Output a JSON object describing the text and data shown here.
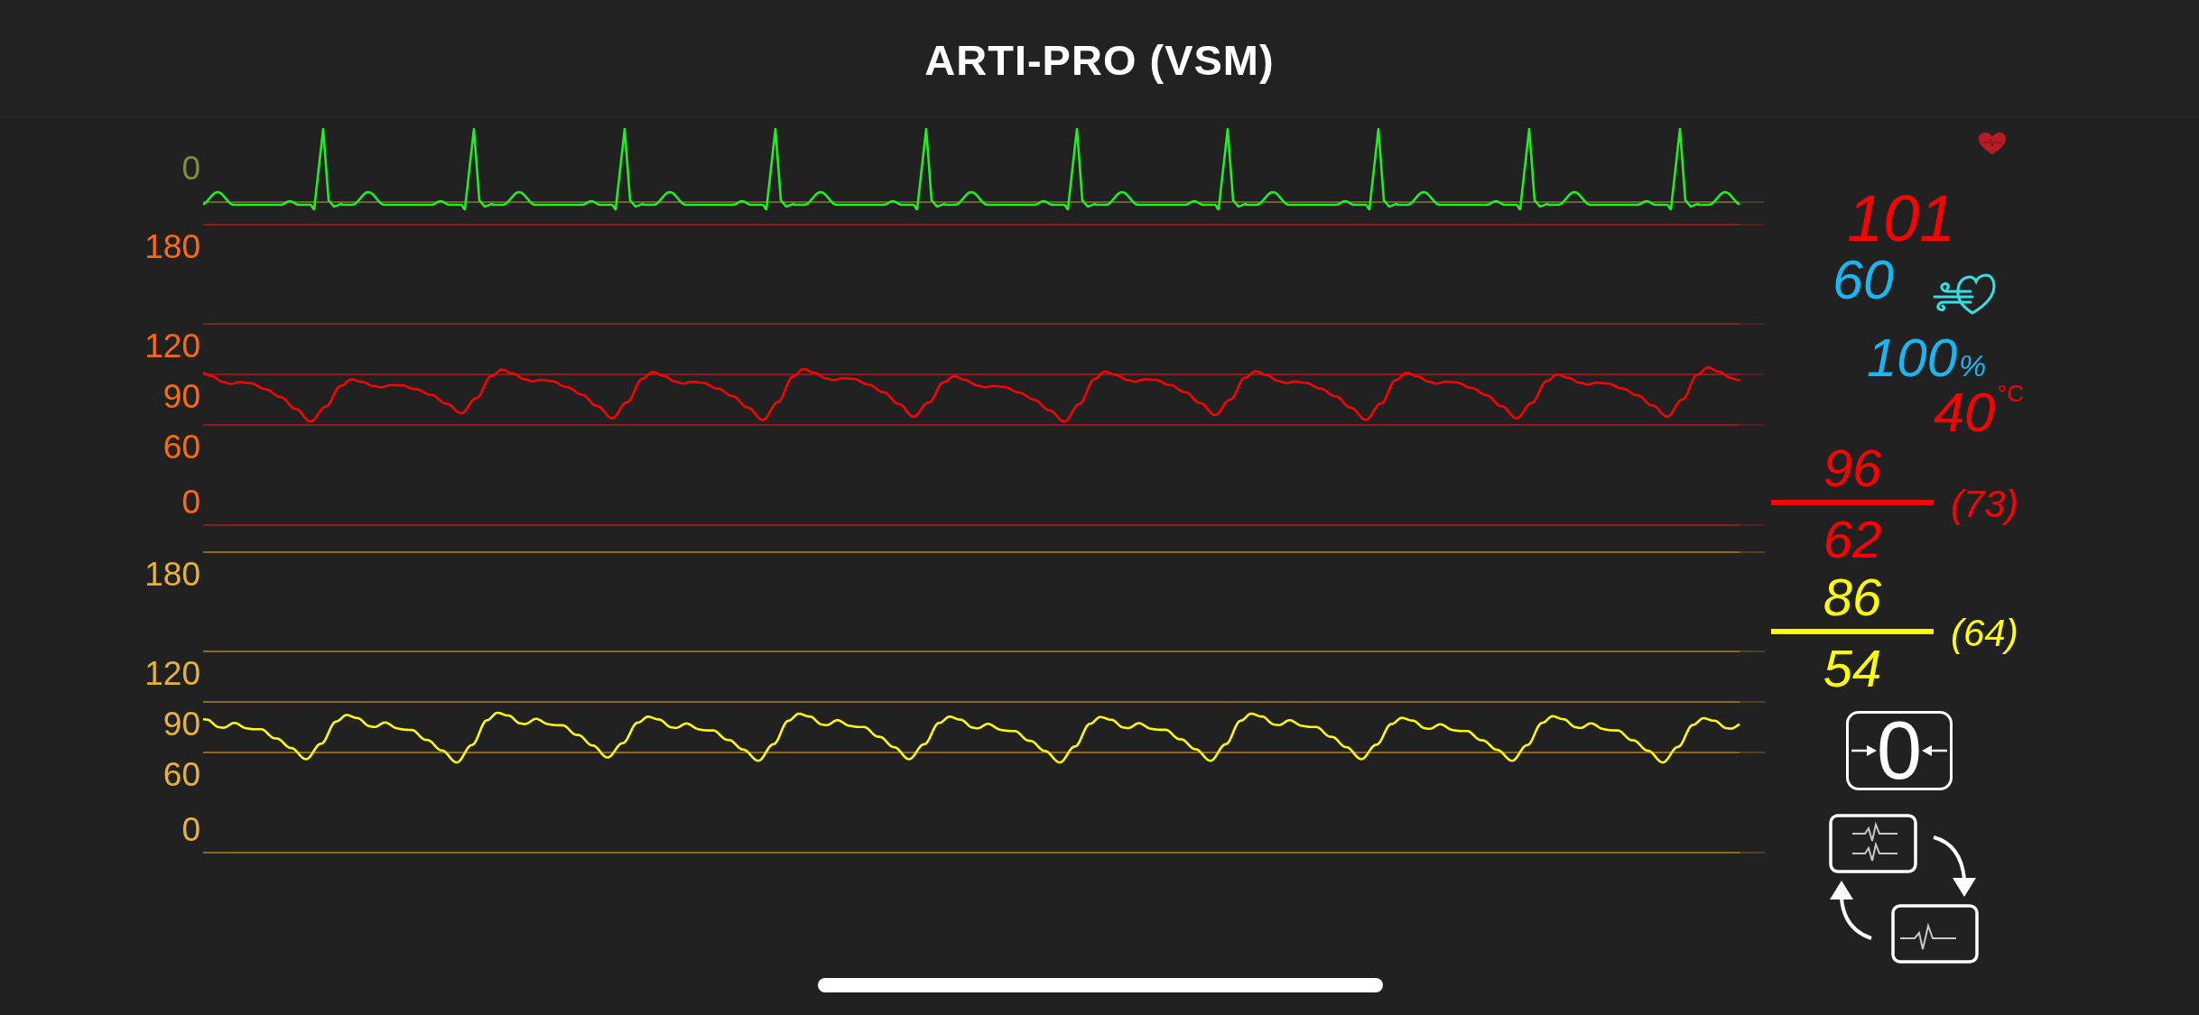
{
  "header": {
    "title": "ARTI-PRO (VSM)"
  },
  "waveforms": [
    {
      "kind": "ecg",
      "color": "#22ee22",
      "scale": [
        "0"
      ]
    },
    {
      "kind": "pressure",
      "color": "#ff0000",
      "scale": [
        "180",
        "120",
        "90",
        "60",
        "0"
      ]
    },
    {
      "kind": "pressure",
      "color": "#ffff00",
      "scale": [
        "180",
        "120",
        "90",
        "60",
        "0"
      ]
    }
  ],
  "vitals": [
    {
      "kind": "value",
      "value": "101",
      "color": "#ff0000"
    },
    {
      "kind": "value_icon",
      "value": "60",
      "color": "#18b6f2"
    },
    {
      "kind": "unit",
      "value": "100",
      "unit": "%",
      "color": "#18b6f2"
    },
    {
      "kind": "superscript",
      "value": "40",
      "unit": "°C",
      "color": "#ff0000"
    },
    {
      "kind": "fraction",
      "systolic": "96",
      "diastolic": "62",
      "mean": "(73)",
      "color": "#ff0000"
    },
    {
      "kind": "fraction",
      "systolic": "86",
      "diastolic": "54",
      "mean": "(64)",
      "color": "#ffff00"
    }
  ],
  "controls": [
    {
      "kind": "zero",
      "label": "0"
    },
    {
      "kind": "layout_switch"
    }
  ]
}
